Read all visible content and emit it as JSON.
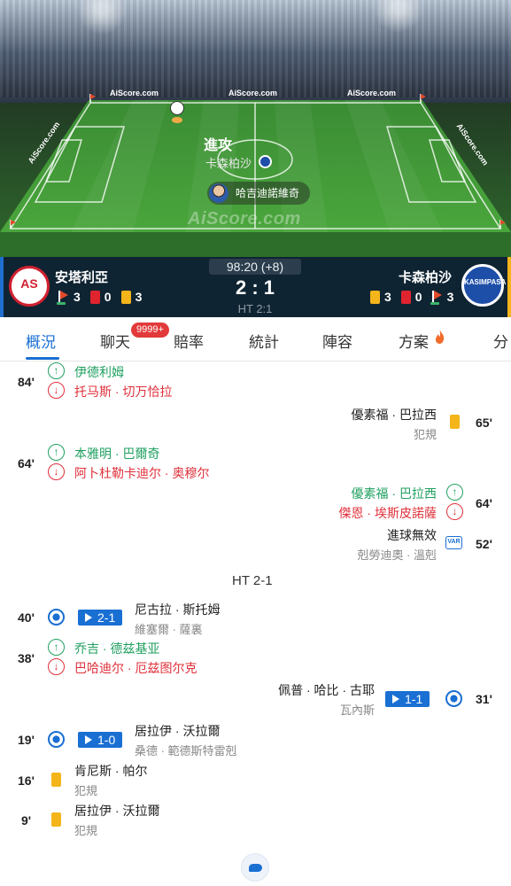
{
  "pitch": {
    "sponsor": "AiScore.com",
    "watermark": "AiScore.com",
    "event_title": "進攻",
    "event_team": "卡森柏沙",
    "event_player": "哈吉迪諾維奇"
  },
  "match": {
    "home_name": "安塔利亞",
    "away_name": "卡森柏沙",
    "home_logo_text": "AS",
    "away_logo_text": "KASIMPASA",
    "time": "98:20 (+8)",
    "score": "2 : 1",
    "ht_score": "HT 2:1",
    "home_stats": {
      "corners": "3",
      "red": "0",
      "yellow": "3"
    },
    "away_stats": {
      "yellow": "3",
      "red": "0",
      "corners": "3"
    }
  },
  "tabs": {
    "items": [
      "概況",
      "聊天",
      "賠率",
      "統計",
      "陣容",
      "方案",
      "分"
    ],
    "active": "概況",
    "chat_badge": "9999+"
  },
  "events": {
    "ht_label": "HT 2-1",
    "e84": {
      "minute": "84'",
      "in": "伊德利姆",
      "out": "托马斯 · 切万恰拉"
    },
    "e65": {
      "minute": "65'",
      "player": "優素福 · 巴拉西",
      "note": "犯規"
    },
    "e64h": {
      "minute": "64'",
      "in": "本雅明 · 巴爾奇",
      "out": "阿卜杜勒卡迪尔 · 奥穆尔"
    },
    "e64a": {
      "minute": "64'",
      "in": "優素福 · 巴拉西",
      "out": "傑恩 · 埃斯皮諾薩"
    },
    "e52": {
      "minute": "52'",
      "title": "進球無效",
      "player": "剋勞迪奧 · 溫剋",
      "var": "VAR"
    },
    "e40": {
      "minute": "40'",
      "score": "2-1",
      "scorer": "尼古拉 · 斯托姆",
      "assist": "維塞爾 · 薩裏"
    },
    "e38": {
      "minute": "38'",
      "in": "乔吉 · 德兹基亚",
      "out": "巴哈迪尔 · 厄兹图尔克"
    },
    "e31": {
      "minute": "31'",
      "score": "1-1",
      "scorer": "佩普 · 哈比 · 古耶",
      "assist": "瓦內斯"
    },
    "e19": {
      "minute": "19'",
      "score": "1-0",
      "scorer": "居拉伊 · 沃拉爾",
      "assist": "桑德 · 範德斯特雷剋"
    },
    "e16": {
      "minute": "16'",
      "player": "肯尼斯 · 帕尔",
      "note": "犯規"
    },
    "e9": {
      "minute": "9'",
      "player": "居拉伊 · 沃拉爾",
      "note": "犯規"
    }
  }
}
